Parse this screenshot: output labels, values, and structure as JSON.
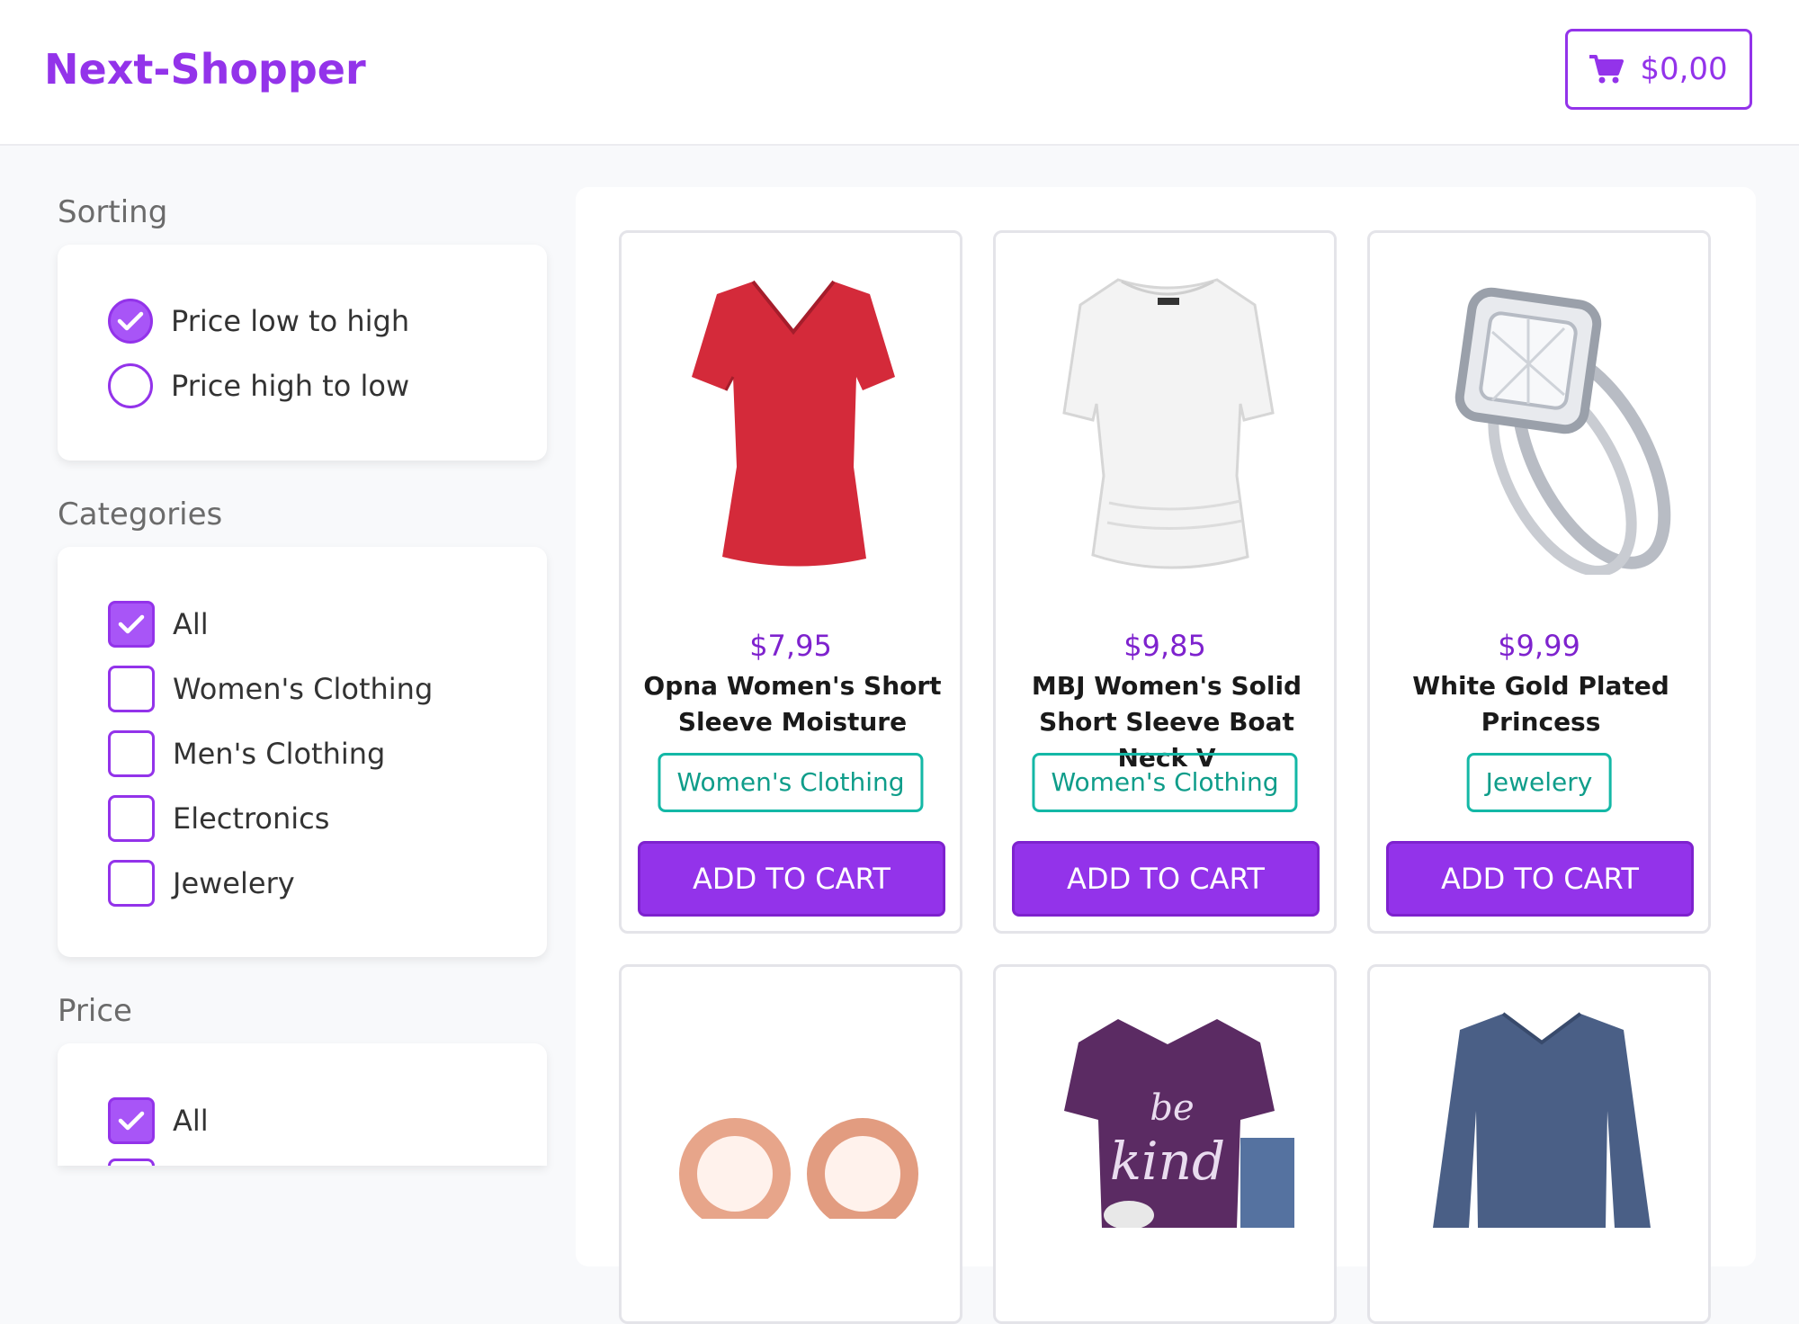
{
  "header": {
    "brand": "Next-Shopper",
    "cart_total": "$0,00"
  },
  "sidebar": {
    "sorting": {
      "title": "Sorting",
      "options": [
        {
          "label": "Price low to high",
          "selected": true
        },
        {
          "label": "Price high to low",
          "selected": false
        }
      ]
    },
    "categories": {
      "title": "Categories",
      "options": [
        {
          "label": "All",
          "checked": true
        },
        {
          "label": "Women's Clothing",
          "checked": false
        },
        {
          "label": "Men's Clothing",
          "checked": false
        },
        {
          "label": "Electronics",
          "checked": false
        },
        {
          "label": "Jewelery",
          "checked": false
        }
      ]
    },
    "price": {
      "title": "Price",
      "options": [
        {
          "label": "All",
          "checked": true
        }
      ]
    }
  },
  "products": [
    {
      "price": "$7,95",
      "name": "Opna Women's Short Sleeve Moisture",
      "category": "Women's Clothing",
      "button": "ADD TO CART"
    },
    {
      "price": "$9,85",
      "name": "MBJ Women's Solid Short Sleeve Boat Neck V",
      "category": "Women's Clothing",
      "button": "ADD TO CART"
    },
    {
      "price": "$9,99",
      "name": "White Gold Plated Princess",
      "category": "Jewelery",
      "button": "ADD TO CART"
    }
  ],
  "images": {
    "be_kind_text": "be kind"
  },
  "colors": {
    "accent": "#9333ea",
    "category_badge": "#14b8a6"
  }
}
